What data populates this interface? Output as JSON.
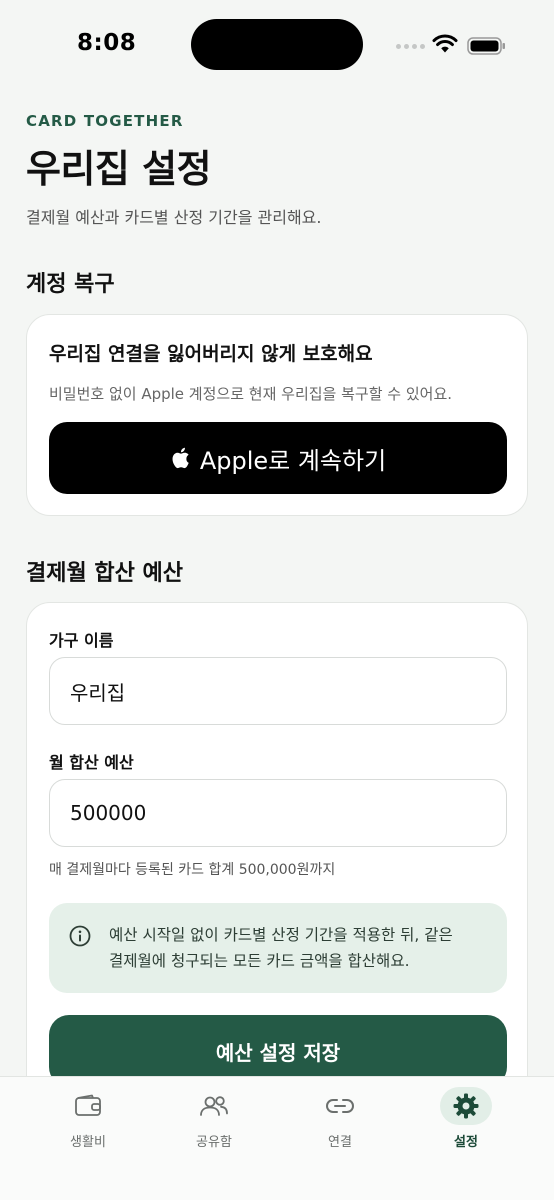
{
  "status_bar": {
    "time": "8:08"
  },
  "header": {
    "eyebrow": "CARD TOGETHER",
    "title": "우리집 설정",
    "subtitle": "결제월 예산과 카드별 산정 기간을 관리해요."
  },
  "account_recovery": {
    "section_title": "계정 복구",
    "heading": "우리집 연결을 잃어버리지 않게 보호해요",
    "description": "비밀번호 없이 Apple 계정으로 현재 우리집을 복구할 수 있어요.",
    "apple_button_label": "Apple로 계속하기"
  },
  "budget": {
    "section_title": "결제월 합산 예산",
    "household_name_label": "가구 이름",
    "household_name_value": "우리집",
    "monthly_budget_label": "월 합산 예산",
    "monthly_budget_value": "500000",
    "hint": "매 결제월마다 등록된 카드 합계 500,000원까지",
    "info_line1": "예산 시작일 없이 카드별 산정 기간을 적용한 뒤, 같은",
    "info_line2": "결제월에 청구되는 모든 카드 금액을 합산해요.",
    "save_button_label": "예산 설정 저장"
  },
  "tabs": [
    {
      "label": "생활비",
      "icon": "wallet-icon",
      "active": false
    },
    {
      "label": "공유함",
      "icon": "people-icon",
      "active": false
    },
    {
      "label": "연결",
      "icon": "link-icon",
      "active": false
    },
    {
      "label": "설정",
      "icon": "gear-icon",
      "active": true
    }
  ],
  "colors": {
    "accent": "#245a46",
    "info_bg": "#e5f0e9",
    "background": "#f4f6f4"
  }
}
